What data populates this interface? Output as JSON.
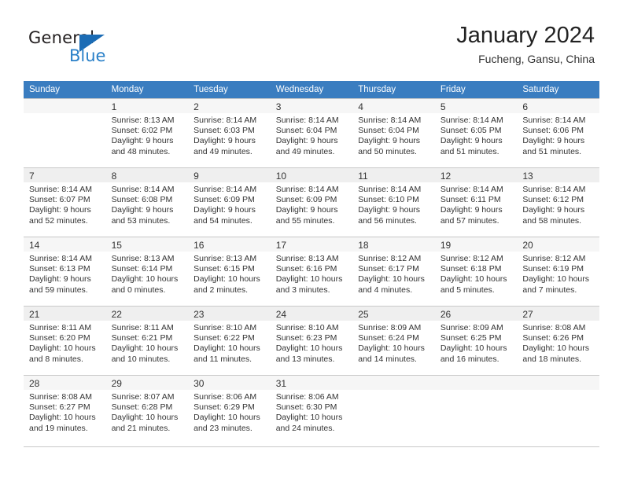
{
  "brand": {
    "name_part1": "General",
    "name_part2": "Blue",
    "triangle_color": "#1b6cb5",
    "blue_color": "#2a80c8"
  },
  "header": {
    "title": "January 2024",
    "location": "Fucheng, Gansu, China",
    "header_bg": "#3a7dc0"
  },
  "calendar": {
    "weekdays": [
      "Sunday",
      "Monday",
      "Tuesday",
      "Wednesday",
      "Thursday",
      "Friday",
      "Saturday"
    ],
    "weeks": [
      [
        {
          "day": "",
          "lines": []
        },
        {
          "day": "1",
          "lines": [
            "Sunrise: 8:13 AM",
            "Sunset: 6:02 PM",
            "Daylight: 9 hours",
            "and 48 minutes."
          ]
        },
        {
          "day": "2",
          "lines": [
            "Sunrise: 8:14 AM",
            "Sunset: 6:03 PM",
            "Daylight: 9 hours",
            "and 49 minutes."
          ]
        },
        {
          "day": "3",
          "lines": [
            "Sunrise: 8:14 AM",
            "Sunset: 6:04 PM",
            "Daylight: 9 hours",
            "and 49 minutes."
          ]
        },
        {
          "day": "4",
          "lines": [
            "Sunrise: 8:14 AM",
            "Sunset: 6:04 PM",
            "Daylight: 9 hours",
            "and 50 minutes."
          ]
        },
        {
          "day": "5",
          "lines": [
            "Sunrise: 8:14 AM",
            "Sunset: 6:05 PM",
            "Daylight: 9 hours",
            "and 51 minutes."
          ]
        },
        {
          "day": "6",
          "lines": [
            "Sunrise: 8:14 AM",
            "Sunset: 6:06 PM",
            "Daylight: 9 hours",
            "and 51 minutes."
          ]
        }
      ],
      [
        {
          "day": "7",
          "lines": [
            "Sunrise: 8:14 AM",
            "Sunset: 6:07 PM",
            "Daylight: 9 hours",
            "and 52 minutes."
          ]
        },
        {
          "day": "8",
          "lines": [
            "Sunrise: 8:14 AM",
            "Sunset: 6:08 PM",
            "Daylight: 9 hours",
            "and 53 minutes."
          ]
        },
        {
          "day": "9",
          "lines": [
            "Sunrise: 8:14 AM",
            "Sunset: 6:09 PM",
            "Daylight: 9 hours",
            "and 54 minutes."
          ]
        },
        {
          "day": "10",
          "lines": [
            "Sunrise: 8:14 AM",
            "Sunset: 6:09 PM",
            "Daylight: 9 hours",
            "and 55 minutes."
          ]
        },
        {
          "day": "11",
          "lines": [
            "Sunrise: 8:14 AM",
            "Sunset: 6:10 PM",
            "Daylight: 9 hours",
            "and 56 minutes."
          ]
        },
        {
          "day": "12",
          "lines": [
            "Sunrise: 8:14 AM",
            "Sunset: 6:11 PM",
            "Daylight: 9 hours",
            "and 57 minutes."
          ]
        },
        {
          "day": "13",
          "lines": [
            "Sunrise: 8:14 AM",
            "Sunset: 6:12 PM",
            "Daylight: 9 hours",
            "and 58 minutes."
          ]
        }
      ],
      [
        {
          "day": "14",
          "lines": [
            "Sunrise: 8:14 AM",
            "Sunset: 6:13 PM",
            "Daylight: 9 hours",
            "and 59 minutes."
          ]
        },
        {
          "day": "15",
          "lines": [
            "Sunrise: 8:13 AM",
            "Sunset: 6:14 PM",
            "Daylight: 10 hours",
            "and 0 minutes."
          ]
        },
        {
          "day": "16",
          "lines": [
            "Sunrise: 8:13 AM",
            "Sunset: 6:15 PM",
            "Daylight: 10 hours",
            "and 2 minutes."
          ]
        },
        {
          "day": "17",
          "lines": [
            "Sunrise: 8:13 AM",
            "Sunset: 6:16 PM",
            "Daylight: 10 hours",
            "and 3 minutes."
          ]
        },
        {
          "day": "18",
          "lines": [
            "Sunrise: 8:12 AM",
            "Sunset: 6:17 PM",
            "Daylight: 10 hours",
            "and 4 minutes."
          ]
        },
        {
          "day": "19",
          "lines": [
            "Sunrise: 8:12 AM",
            "Sunset: 6:18 PM",
            "Daylight: 10 hours",
            "and 5 minutes."
          ]
        },
        {
          "day": "20",
          "lines": [
            "Sunrise: 8:12 AM",
            "Sunset: 6:19 PM",
            "Daylight: 10 hours",
            "and 7 minutes."
          ]
        }
      ],
      [
        {
          "day": "21",
          "lines": [
            "Sunrise: 8:11 AM",
            "Sunset: 6:20 PM",
            "Daylight: 10 hours",
            "and 8 minutes."
          ]
        },
        {
          "day": "22",
          "lines": [
            "Sunrise: 8:11 AM",
            "Sunset: 6:21 PM",
            "Daylight: 10 hours",
            "and 10 minutes."
          ]
        },
        {
          "day": "23",
          "lines": [
            "Sunrise: 8:10 AM",
            "Sunset: 6:22 PM",
            "Daylight: 10 hours",
            "and 11 minutes."
          ]
        },
        {
          "day": "24",
          "lines": [
            "Sunrise: 8:10 AM",
            "Sunset: 6:23 PM",
            "Daylight: 10 hours",
            "and 13 minutes."
          ]
        },
        {
          "day": "25",
          "lines": [
            "Sunrise: 8:09 AM",
            "Sunset: 6:24 PM",
            "Daylight: 10 hours",
            "and 14 minutes."
          ]
        },
        {
          "day": "26",
          "lines": [
            "Sunrise: 8:09 AM",
            "Sunset: 6:25 PM",
            "Daylight: 10 hours",
            "and 16 minutes."
          ]
        },
        {
          "day": "27",
          "lines": [
            "Sunrise: 8:08 AM",
            "Sunset: 6:26 PM",
            "Daylight: 10 hours",
            "and 18 minutes."
          ]
        }
      ],
      [
        {
          "day": "28",
          "lines": [
            "Sunrise: 8:08 AM",
            "Sunset: 6:27 PM",
            "Daylight: 10 hours",
            "and 19 minutes."
          ]
        },
        {
          "day": "29",
          "lines": [
            "Sunrise: 8:07 AM",
            "Sunset: 6:28 PM",
            "Daylight: 10 hours",
            "and 21 minutes."
          ]
        },
        {
          "day": "30",
          "lines": [
            "Sunrise: 8:06 AM",
            "Sunset: 6:29 PM",
            "Daylight: 10 hours",
            "and 23 minutes."
          ]
        },
        {
          "day": "31",
          "lines": [
            "Sunrise: 8:06 AM",
            "Sunset: 6:30 PM",
            "Daylight: 10 hours",
            "and 24 minutes."
          ]
        },
        {
          "day": "",
          "lines": []
        },
        {
          "day": "",
          "lines": []
        },
        {
          "day": "",
          "lines": []
        }
      ]
    ]
  }
}
